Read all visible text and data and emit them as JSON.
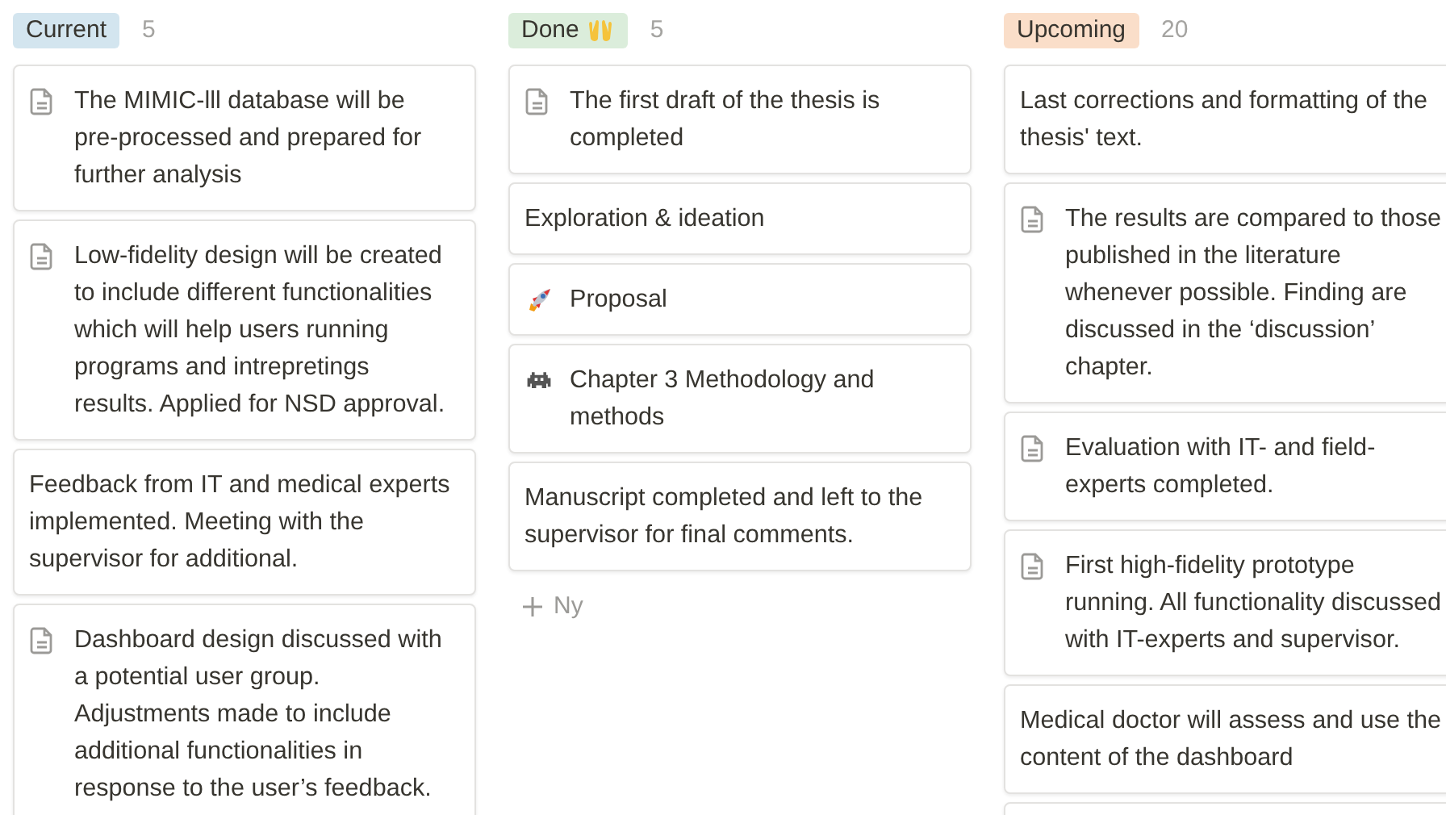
{
  "columns": [
    {
      "title": "Current",
      "color": "#d3e5ef",
      "kind": "plain",
      "count": "5",
      "cards": [
        {
          "kind": "document",
          "text": "The MIMIC-lll database will be pre-processed and prepared for further analysis"
        },
        {
          "kind": "document",
          "text": "Low-fidelity design will be created to include different functionalities which will help users running programs and intrepretings results. Applied for NSD approval."
        },
        {
          "kind": "plain",
          "text": "Feedback from IT and medical experts implemented. Meeting with the supervisor for additional."
        },
        {
          "kind": "document",
          "text": "Dashboard design discussed with a potential user group. Adjustments made to include additional functionalities in response to the user’s feedback."
        }
      ]
    },
    {
      "title": "Done",
      "color": "#dbeddb",
      "kind": "hands",
      "count": "5",
      "cards": [
        {
          "kind": "document",
          "text": "The first draft of the thesis is completed"
        },
        {
          "kind": "plain",
          "text": "Exploration & ideation"
        },
        {
          "kind": "rocket",
          "text": "Proposal"
        },
        {
          "kind": "invader",
          "text": "Chapter 3 Methodology and methods"
        },
        {
          "kind": "plain",
          "text": "Manuscript completed and left to the supervisor for final comments."
        }
      ],
      "new_label": "Ny"
    },
    {
      "title": "Upcoming",
      "color": "#fadec9",
      "kind": "plain",
      "count": "20",
      "cards": [
        {
          "kind": "plain",
          "text": "Last corrections and formatting of the thesis' text."
        },
        {
          "kind": "document",
          "text": "The results are compared to those published in the literature whenever possible. Finding are discussed in the ‘discussion’ chapter."
        },
        {
          "kind": "document",
          "text": "Evaluation with IT- and field-experts completed."
        },
        {
          "kind": "document",
          "text": "First high-fidelity prototype running. All functionality discussed with IT-experts and supervisor."
        },
        {
          "kind": "plain",
          "text": "Medical doctor will assess and use the content of the dashboard"
        },
        {
          "kind": "cut-off"
        }
      ]
    }
  ]
}
